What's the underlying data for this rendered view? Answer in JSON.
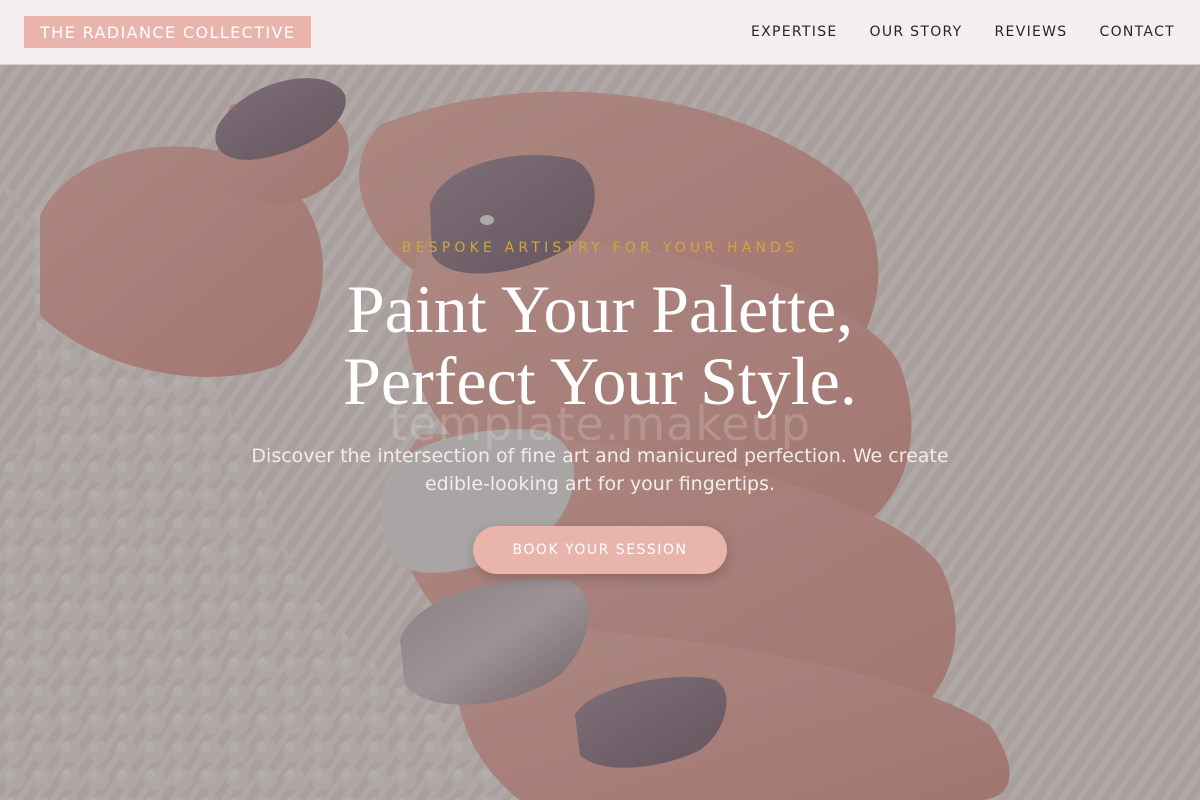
{
  "header": {
    "logo_text": "THE RADIANCE COLLECTIVE",
    "nav": [
      {
        "label": "EXPERTISE"
      },
      {
        "label": "OUR STORY"
      },
      {
        "label": "REVIEWS"
      },
      {
        "label": "CONTACT"
      }
    ]
  },
  "hero": {
    "eyebrow": "BESPOKE ARTISTRY FOR YOUR HANDS",
    "headline_line1": "Paint Your Palette,",
    "headline_line2": "Perfect Your Style.",
    "subtext": "Discover the intersection of fine art and manicured perfection. We create edible-looking art for your fingertips.",
    "cta_label": "BOOK YOUR SESSION",
    "watermark": "template.makeup",
    "background_image": "hand-with-manicured-nails-photo"
  },
  "colors": {
    "accent": "#e8b4ab",
    "eyebrow_gold": "#d2a63d",
    "header_bg": "#f4eeee",
    "nail_mauve": "#8f7f8a",
    "nail_white": "#f1f1f1"
  }
}
